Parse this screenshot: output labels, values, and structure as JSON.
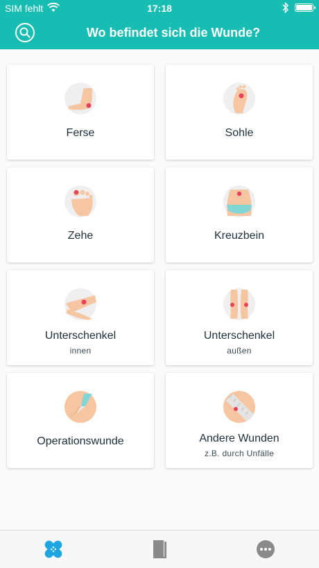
{
  "status": {
    "carrier": "SIM fehlt",
    "time": "17:18"
  },
  "header": {
    "title": "Wo befindet sich die Wunde?"
  },
  "cards": [
    {
      "label": "Ferse"
    },
    {
      "label": "Sohle"
    },
    {
      "label": "Zehe"
    },
    {
      "label": "Kreuzbein"
    },
    {
      "label": "Unterschenkel",
      "sub": "innen"
    },
    {
      "label": "Unterschenkel",
      "sub": "außen"
    },
    {
      "label": "Operationswunde"
    },
    {
      "label": "Andere Wunden",
      "sub": "z.B. durch Unfälle"
    }
  ],
  "colors": {
    "accent": "#17bcb3",
    "active_tab": "#1fa6e0",
    "wound": "#e8425a",
    "skin": "#f6c6a2"
  }
}
